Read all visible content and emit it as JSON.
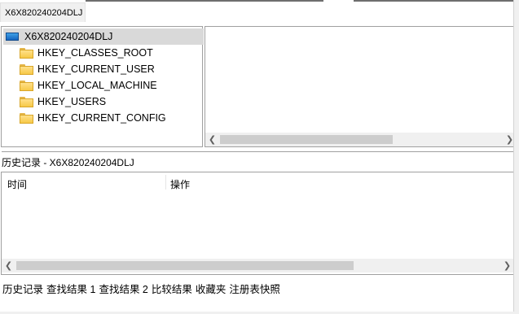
{
  "top": {
    "tab_label": "X6X820240204DLJ"
  },
  "tree": {
    "root": "X6X820240204DLJ",
    "items": [
      {
        "label": "HKEY_CLASSES_ROOT"
      },
      {
        "label": "HKEY_CURRENT_USER"
      },
      {
        "label": "HKEY_LOCAL_MACHINE"
      },
      {
        "label": "HKEY_USERS"
      },
      {
        "label": "HKEY_CURRENT_CONFIG"
      }
    ]
  },
  "history": {
    "title": "历史记录 - X6X820240204DLJ",
    "columns": [
      "时间",
      "操作"
    ]
  },
  "bottom_tabs": [
    "历史记录",
    "查找结果 1",
    "查找结果 2",
    "比较结果",
    "收藏夹",
    "注册表快照"
  ],
  "icons": {
    "root": "computer-icon",
    "hive": "folder-icon",
    "scroll_left": "scroll-left-arrow-icon",
    "scroll_right": "scroll-right-arrow-icon"
  },
  "colors": {
    "selection": "#d9d9d9",
    "border": "#a0a0a0",
    "scrollbar_track": "#f0f0f0",
    "scrollbar_thumb": "#cdcdcd",
    "folder": "#f7c948",
    "computer": "#1e78d2"
  }
}
